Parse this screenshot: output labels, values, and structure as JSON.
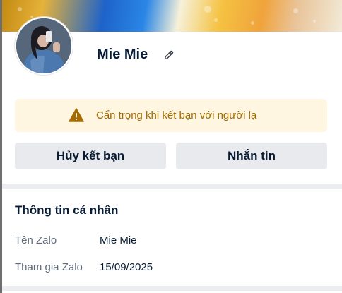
{
  "profile": {
    "name": "Mie Mie",
    "avatar_icon": "avatar-photo",
    "edit_icon": "pencil-icon"
  },
  "warning": {
    "text": "Cẩn trọng khi kết bạn với người lạ",
    "icon": "warning-triangle-icon",
    "color": "#a36b00",
    "background": "#fef6e1"
  },
  "actions": {
    "unfriend_label": "Hủy kết bạn",
    "message_label": "Nhắn tin"
  },
  "personal_info": {
    "title": "Thông tin cá nhân",
    "rows": [
      {
        "label": "Tên Zalo",
        "value": "Mie Mie"
      },
      {
        "label": "Tham gia Zalo",
        "value": "15/09/2025"
      }
    ]
  }
}
